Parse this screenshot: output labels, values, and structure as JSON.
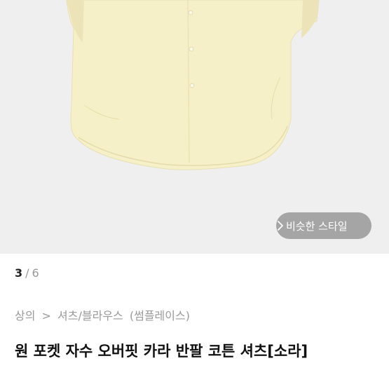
{
  "gallery": {
    "product_image": "cream-short-sleeve-shirt",
    "similar_style_button": "비슷한 스타일",
    "chevron": "chevron-right-icon",
    "current_index": "3",
    "separator": "/",
    "total": "6"
  },
  "breadcrumb": {
    "items": [
      "상의",
      ">",
      "셔츠/블라우스",
      "(썸플레이스)"
    ]
  },
  "product": {
    "title": "원 포켓 자수 오버핏 카라 반팔 코튼 셔츠[소라]"
  },
  "colors": {
    "gallery_bg": "#efefef",
    "shirt": "#f6f0c8",
    "text_dark": "#111111",
    "text_muted": "#9a9a9a"
  }
}
